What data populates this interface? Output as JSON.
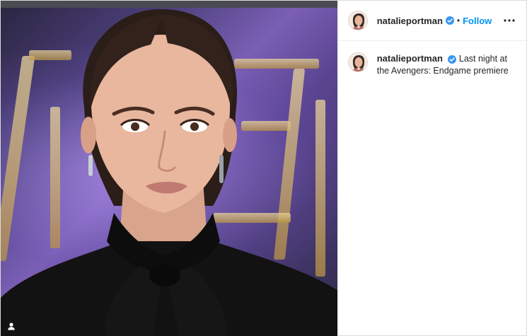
{
  "post": {
    "image": {
      "alt_icon": "user-tag-icon"
    },
    "header": {
      "username": "natalieportman",
      "verified": true,
      "separator": "•",
      "follow_label": "Follow",
      "more_icon": "more-horizontal-icon"
    },
    "caption": {
      "username": "natalieportman",
      "text": "Last night at the Avengers: Endgame premiere"
    },
    "colors": {
      "link_blue": "#0095f6",
      "verified_blue": "#3897f0",
      "text": "#262626",
      "border": "#dbdbdb"
    }
  }
}
